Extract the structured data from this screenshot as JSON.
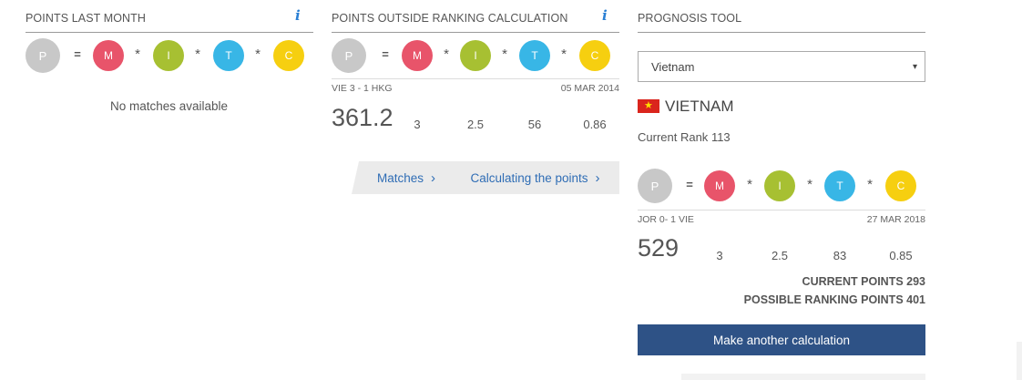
{
  "formula": {
    "p": "P",
    "m": "M",
    "i": "I",
    "t": "T",
    "c": "C",
    "eq": "=",
    "times": "*"
  },
  "last_month": {
    "title": "POINTS LAST MONTH",
    "info": "i",
    "empty_text": "No matches available"
  },
  "outside": {
    "title": "POINTS OUTSIDE RANKING CALCULATION",
    "info": "i",
    "match_home": "VIE",
    "match_score": "3 - 1",
    "match_away": "HKG",
    "date": "05 MAR 2014",
    "points": "361.2",
    "m": "3",
    "i": "2.5",
    "t": "56",
    "c": "0.86",
    "matches_label": "Matches",
    "calc_label": "Calculating the points",
    "chevron": "›"
  },
  "prognosis": {
    "title": "PROGNOSIS TOOL",
    "selected_country": "Vietnam",
    "select_arrow": "▾",
    "country_name": "VIETNAM",
    "rank_label": "Current Rank",
    "rank_value": "113",
    "match_home": "JOR",
    "match_score": "0- 1",
    "match_away": "VIE",
    "date": "27 MAR 2018",
    "points": "529",
    "m": "3",
    "i": "2.5",
    "t": "83",
    "c": "0.85",
    "current_points": "CURRENT POINTS 293",
    "possible_points": "POSSIBLE RANKING POINTS 401",
    "button_label": "Make another calculation"
  },
  "colors": {
    "m": "#e8546a",
    "i": "#a7c032",
    "t": "#38b6e6",
    "c": "#f6cf10",
    "p": "#c8c8c8",
    "button": "#2e5286",
    "link": "#2f6db5"
  }
}
